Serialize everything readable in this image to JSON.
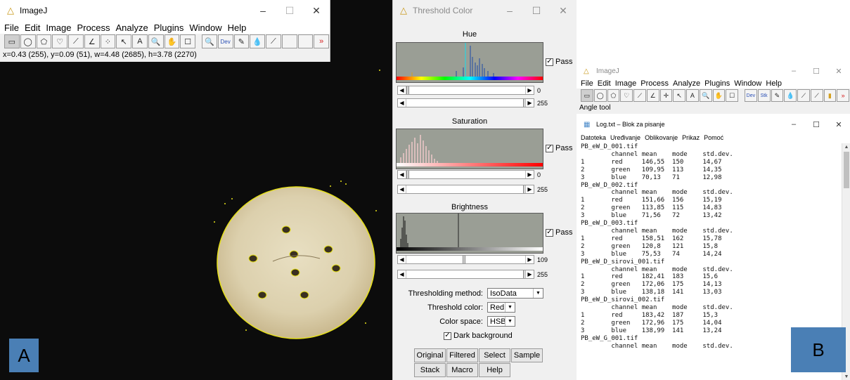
{
  "imagej_main": {
    "title": "ImageJ",
    "window_buttons": [
      "–",
      "☐",
      "✕"
    ],
    "menu": [
      "File",
      "Edit",
      "Image",
      "Process",
      "Analyze",
      "Plugins",
      "Window",
      "Help"
    ],
    "tools": [
      "▭",
      "◯",
      "⬠",
      "♡",
      "⟋",
      "∠",
      "⁘",
      "↖",
      "A",
      "🔍",
      "✋",
      "☐",
      "🔍",
      "Dev",
      "✎",
      "💧",
      "⟋",
      "",
      "",
      "»"
    ],
    "status": "x=0.43 (255), y=0.09 (51), w=4.48 (2685), h=3.78 (2270)"
  },
  "labels": {
    "a": "A",
    "b": "B"
  },
  "threshold": {
    "title": "Threshold Color",
    "window_buttons": [
      "–",
      "☐",
      "✕"
    ],
    "hue": {
      "label": "Hue",
      "pass": "Pass",
      "min": "0",
      "max": "255"
    },
    "saturation": {
      "label": "Saturation",
      "pass": "Pass",
      "min": "0",
      "max": "255"
    },
    "brightness": {
      "label": "Brightness",
      "pass": "Pass",
      "min": "109",
      "max": "255"
    },
    "method_label": "Thresholding method:",
    "method_value": "IsoData",
    "color_label": "Threshold color:",
    "color_value": "Red",
    "space_label": "Color space:",
    "space_value": "HSB",
    "dark_bg": "Dark background",
    "buttons": [
      "Original",
      "Filtered",
      "Select",
      "Sample",
      "Stack",
      "Macro",
      "Help"
    ]
  },
  "imagej_small": {
    "title": "ImageJ",
    "window_buttons": [
      "–",
      "☐",
      "✕"
    ],
    "menu": [
      "File",
      "Edit",
      "Image",
      "Process",
      "Analyze",
      "Plugins",
      "Window",
      "Help"
    ],
    "tools": [
      "▭",
      "◯",
      "⬠",
      "♡",
      "⟋",
      "∠",
      "✛",
      "↖",
      "A",
      "🔍",
      "✋",
      "☐",
      "Dev",
      "Stk",
      "✎",
      "💧",
      "⟋",
      "⟋",
      "▮",
      "»"
    ],
    "status": "Angle tool"
  },
  "log": {
    "title": "Log.txt – Blok za pisanje",
    "window_buttons": [
      "–",
      "☐",
      "✕"
    ],
    "menu": [
      "Datoteka",
      "Uređivanje",
      "Oblikovanje",
      "Prikaz",
      "Pomoć"
    ],
    "lines": [
      "PB_eW_D_001.tif",
      "        channel mean    mode    std.dev.",
      "1       red     146,55  150     14,67",
      "2       green   109,95  113     14,35",
      "3       blue    70,13   71      12,98",
      "PB_eW_D_002.tif",
      "        channel mean    mode    std.dev.",
      "1       red     151,66  156     15,19",
      "2       green   113,85  115     14,83",
      "3       blue    71,56   72      13,42",
      "PB_eW_D_003.tif",
      "        channel mean    mode    std.dev.",
      "1       red     158,51  162     15,78",
      "2       green   120,8   121     15,8",
      "3       blue    75,53   74      14,24",
      "PB_eW_D_sirovi_001.tif",
      "        channel mean    mode    std.dev.",
      "1       red     182,41  183     15,6",
      "2       green   172,06  175     14,13",
      "3       blue    138,18  141     13,03",
      "PB_eW_D_sirovi_002.tif",
      "        channel mean    mode    std.dev.",
      "1       red     183,42  187     15,3",
      "2       green   172,96  175     14,04",
      "3       blue    138,99  141     13,24",
      "PB_eW_G_001.tif",
      "        channel mean    mode    std.dev."
    ]
  },
  "colors": {
    "background_dark": "#0c0c0c",
    "biscuit": "#ddd2b2",
    "outline": "#e6e01a",
    "label_blue": "#4a7fb5",
    "hist_bg": "#9a9e95"
  }
}
